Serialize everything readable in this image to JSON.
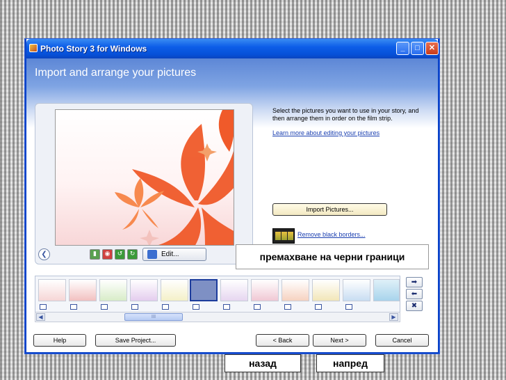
{
  "window": {
    "title": "Photo Story 3 for Windows",
    "minimize_label": "_",
    "maximize_label": "□",
    "close_label": "✕"
  },
  "header": {
    "heading": "Import and arrange your pictures"
  },
  "preview": {
    "edit_label": "Edit..."
  },
  "instructions": {
    "text": "Select the pictures you want to use in your story, and then arrange them in order on the film strip.",
    "learn_link": "Learn more about editing your pictures"
  },
  "actions": {
    "import_label": "Import Pictures...",
    "remove_borders_label": "Remove black borders..."
  },
  "filmstrip": {
    "count": 12,
    "selected_index": 5
  },
  "scrollbar": {
    "thumb_label": "III"
  },
  "footer": {
    "help_label": "Help",
    "save_label": "Save Project...",
    "back_label": "< Back",
    "next_label": "Next >",
    "cancel_label": "Cancel"
  },
  "overlay": {
    "callout": "премахване на черни граници",
    "back_label": "назад",
    "next_label": "напред"
  },
  "colors": {
    "titlebar": "#0650d8",
    "header": "#7fa4e3",
    "link": "#1a3fb0",
    "flower": "#f05a2a"
  }
}
